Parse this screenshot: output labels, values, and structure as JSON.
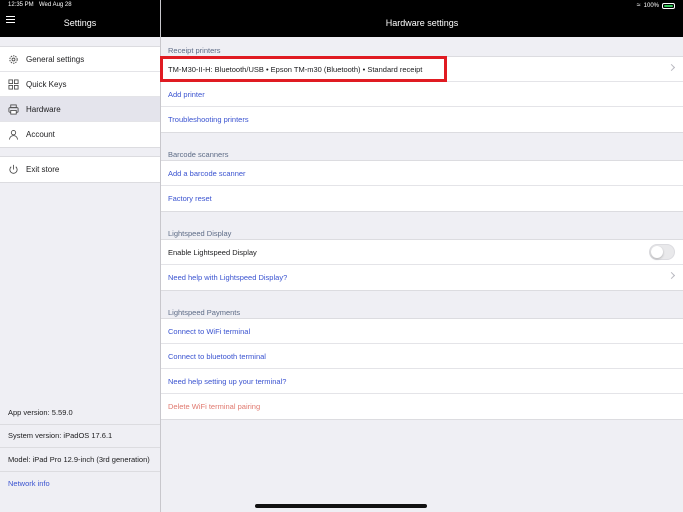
{
  "status": {
    "time": "12:35 PM",
    "date": "Wed Aug 28",
    "battery": "100%"
  },
  "sidebar": {
    "title": "Settings",
    "items": [
      {
        "label": "General settings",
        "icon": "gear-icon"
      },
      {
        "label": "Quick Keys",
        "icon": "grid-icon"
      },
      {
        "label": "Hardware",
        "icon": "printer-icon",
        "active": true
      },
      {
        "label": "Account",
        "icon": "user-icon"
      }
    ],
    "exit_label": "Exit store",
    "app_version": "App version: 5.59.0",
    "system_version": "System version: iPadOS 17.6.1",
    "model": "Model: iPad Pro 12.9-inch (3rd generation)",
    "network_info": "Network info"
  },
  "main": {
    "title": "Hardware settings",
    "receipt": {
      "header": "Receipt printers",
      "printer": "TM-M30-II-H:  Bluetooth/USB • Epson TM-m30 (Bluetooth) • Standard receipt",
      "add": "Add printer",
      "troubleshoot": "Troubleshooting printers"
    },
    "barcode": {
      "header": "Barcode scanners",
      "add": "Add a barcode scanner",
      "reset": "Factory reset"
    },
    "display": {
      "header": "Lightspeed Display",
      "enable": "Enable Lightspeed Display",
      "enabled": false,
      "help": "Need help with Lightspeed Display?"
    },
    "payments": {
      "header": "Lightspeed Payments",
      "wifi": "Connect to WiFi terminal",
      "bluetooth": "Connect to bluetooth terminal",
      "help": "Need help setting up your terminal?",
      "delete": "Delete WiFi terminal pairing"
    }
  },
  "colors": {
    "accent": "#3a53d0",
    "danger": "#e0796f",
    "highlight": "#e01b22",
    "bar": "#000000"
  }
}
